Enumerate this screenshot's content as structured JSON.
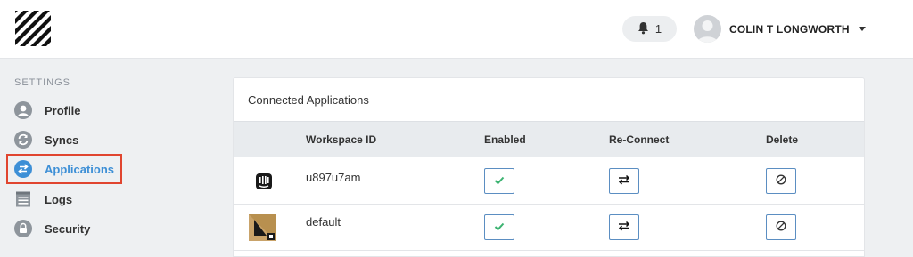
{
  "header": {
    "notification_count": "1",
    "user_name": "COLIN T LONGWORTH"
  },
  "sidebar": {
    "section_label": "SETTINGS",
    "items": [
      {
        "label": "Profile",
        "icon": "user-icon",
        "active": false
      },
      {
        "label": "Syncs",
        "icon": "sync-icon",
        "active": false
      },
      {
        "label": "Applications",
        "icon": "swap-arrows-icon",
        "active": true
      },
      {
        "label": "Logs",
        "icon": "list-icon",
        "active": false
      },
      {
        "label": "Security",
        "icon": "lock-icon",
        "active": false
      }
    ]
  },
  "panel": {
    "title": "Connected Applications",
    "columns": {
      "workspace_id": "Workspace ID",
      "enabled": "Enabled",
      "reconnect": "Re-Connect",
      "delete": "Delete"
    },
    "rows": [
      {
        "app_icon": "intercom-icon",
        "workspace_id": "u897u7am",
        "enabled": true
      },
      {
        "app_icon": "app-logo-icon",
        "workspace_id": "default",
        "enabled": true
      }
    ]
  },
  "colors": {
    "accent": "#3d8fd6",
    "check": "#3cb371",
    "highlight_box": "#e0452f"
  }
}
